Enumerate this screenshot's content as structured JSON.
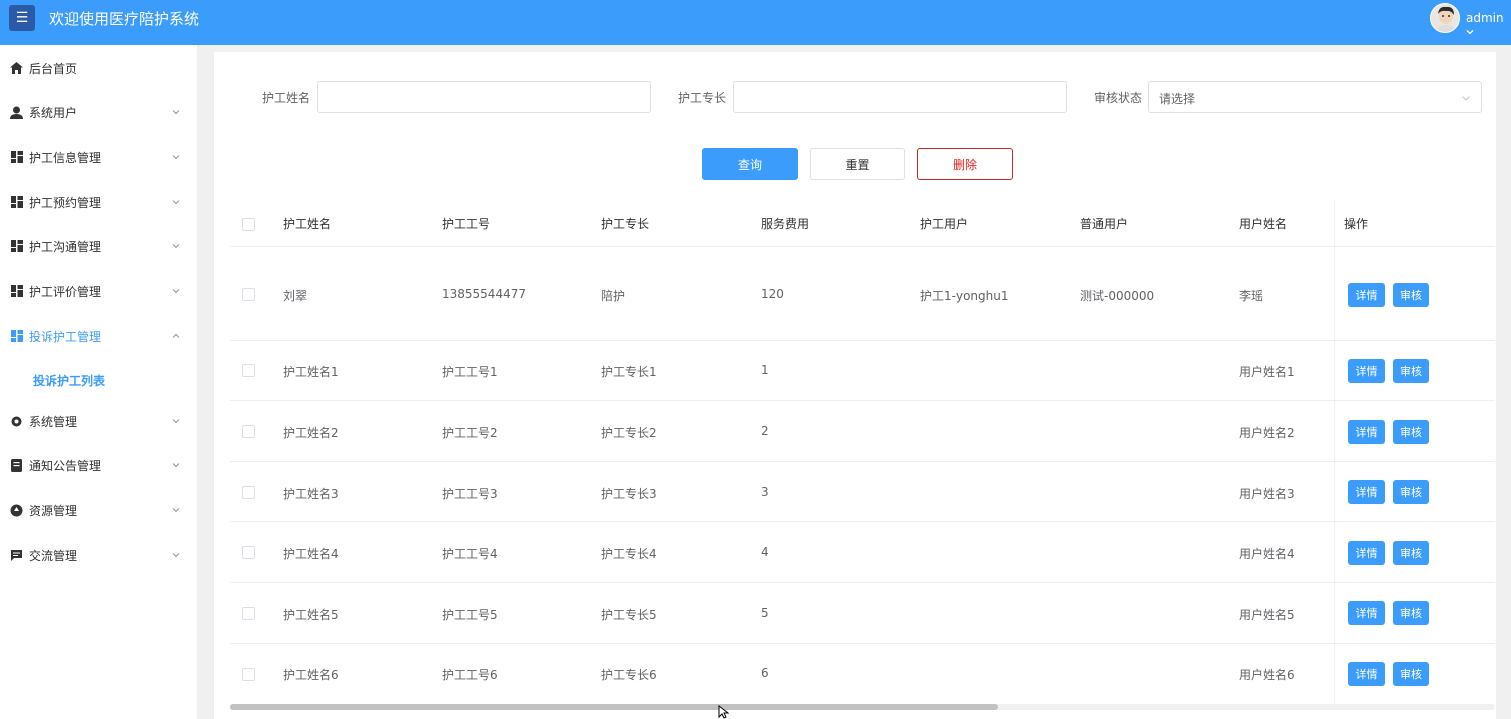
{
  "header": {
    "title": "欢迎使用医疗陪护系统",
    "menu_icon": "☰",
    "user": "admin"
  },
  "sidebar": {
    "items": [
      {
        "label": "后台首页",
        "icon": "home-icon",
        "expandable": false
      },
      {
        "label": "系统用户",
        "icon": "user-icon",
        "expandable": true
      },
      {
        "label": "护工信息管理",
        "icon": "grid-icon",
        "expandable": true
      },
      {
        "label": "护工预约管理",
        "icon": "grid-icon",
        "expandable": true
      },
      {
        "label": "护工沟通管理",
        "icon": "grid-icon",
        "expandable": true
      },
      {
        "label": "护工评价管理",
        "icon": "grid-icon",
        "expandable": true
      },
      {
        "label": "投诉护工管理",
        "icon": "grid-icon",
        "expandable": true,
        "active": true
      },
      {
        "label": "系统管理",
        "icon": "gear-icon",
        "expandable": true
      },
      {
        "label": "通知公告管理",
        "icon": "document-icon",
        "expandable": true
      },
      {
        "label": "资源管理",
        "icon": "resource-icon",
        "expandable": true
      },
      {
        "label": "交流管理",
        "icon": "chat-icon",
        "expandable": true
      }
    ],
    "active_sub": "投诉护工列表"
  },
  "search": {
    "name_label": "护工姓名",
    "name_value": "",
    "specialty_label": "护工专长",
    "specialty_value": "",
    "status_label": "审核状态",
    "status_placeholder": "请选择",
    "query_btn": "查询",
    "reset_btn": "重置",
    "delete_btn": "删除"
  },
  "table": {
    "columns": [
      "护工姓名",
      "护工工号",
      "护工专长",
      "服务费用",
      "护工用户",
      "普通用户",
      "用户姓名",
      "操作"
    ],
    "rows": [
      [
        "刘翠",
        "13855544477",
        "陪护",
        "120",
        "护工1-yonghu1",
        "测试-000000",
        "李瑶"
      ],
      [
        "护工姓名1",
        "护工工号1",
        "护工专长1",
        "1",
        "",
        "",
        "用户姓名1"
      ],
      [
        "护工姓名2",
        "护工工号2",
        "护工专长2",
        "2",
        "",
        "",
        "用户姓名2"
      ],
      [
        "护工姓名3",
        "护工工号3",
        "护工专长3",
        "3",
        "",
        "",
        "用户姓名3"
      ],
      [
        "护工姓名4",
        "护工工号4",
        "护工专长4",
        "4",
        "",
        "",
        "用户姓名4"
      ],
      [
        "护工姓名5",
        "护工工号5",
        "护工专长5",
        "5",
        "",
        "",
        "用户姓名5"
      ],
      [
        "护工姓名6",
        "护工工号6",
        "护工专长6",
        "6",
        "",
        "",
        "用户姓名6"
      ]
    ],
    "detail_btn": "详情",
    "audit_btn": "审核"
  },
  "colors": {
    "primary": "#3c9cfb",
    "danger": "#c62828",
    "header_bg": "#3c9cfb",
    "menu_toggle_bg": "#2b5ba8"
  }
}
